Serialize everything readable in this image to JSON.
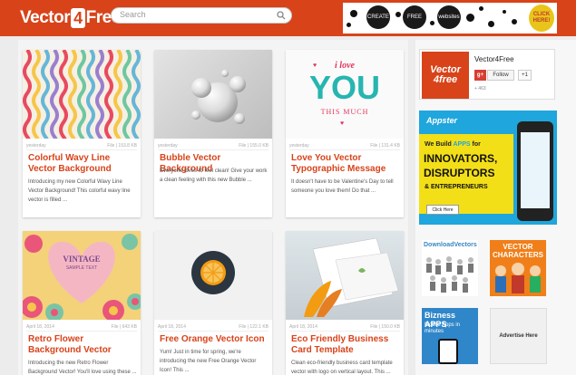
{
  "header": {
    "logo_text_pre": "Vector",
    "logo_text_num": "4",
    "logo_text_post": "Free",
    "search_placeholder": "Search",
    "top_ad": {
      "bubbles": [
        "CREATE",
        "FREE",
        "websites"
      ],
      "click_here": "CLICK HERE!"
    }
  },
  "posts": [
    {
      "title": "Colorful Wavy Line Vector Background",
      "desc": "Introducing my new Colorful Wavy Line Vector Background! This colorful wavy line vector is filled ...",
      "date": "yesterday",
      "size": "File | 153.8 KB"
    },
    {
      "title": "Bubble Vector Background",
      "desc": "Everyone loves to feel clean! Give your work a clean feeling with this new Bubble ...",
      "date": "yesterday",
      "size": "File | 155.0 KB"
    },
    {
      "title": "Love You Vector Typographic Message",
      "desc": "It doesn't have to be Valentine's Day to tell someone you love them! Do that ...",
      "date": "yesterday",
      "size": "File | 131.4 KB",
      "art": {
        "line1": "i love",
        "line2": "YOU",
        "line3": "THIS MUCH"
      }
    },
    {
      "title": "Retro Flower Background Vector",
      "desc": "Introducing the new Retro Flower Background Vector! You'll love using these ...",
      "date": "April 18, 2014",
      "size": "File | 643 KB",
      "art": {
        "line1": "VINTAGE",
        "line2": "SAMPLE TEXT"
      }
    },
    {
      "title": "Free Orange Vector Icon",
      "desc": "Yum! Just in time for spring, we're introducing the new Free Orange Vector Icon! This ...",
      "date": "April 18, 2014",
      "size": "File | 122.1 KB"
    },
    {
      "title": "Eco Friendly Business Card Template",
      "desc": "Clean eco-friendly business card template vector with logo on vertical layout. This ...",
      "date": "April 18, 2014",
      "size": "File | 150.0 KB"
    }
  ],
  "sidebar": {
    "gplus": {
      "logo": "Vector 4free",
      "name": "Vector4Free",
      "gplus_label": "g+",
      "follow": "Follow",
      "plus_one": "+1",
      "count": "+ 463"
    },
    "appster": {
      "brand": "Appster",
      "line1_pre": "We Build ",
      "line1_em": "APPS",
      "line1_post": " for",
      "big1": "INNOVATORS,",
      "big2": "DISRUPTORS",
      "line3": "& ENTREPRENEURS",
      "button": "Click Here"
    },
    "ads": {
      "download_vectors": "DownloadVectors",
      "vector_characters": "VECTOR CHARACTERS",
      "bizness_apps": "Bizness APPS",
      "bizness_sub": "Mobile Apps in minutes",
      "advertise": "Advertise Here"
    }
  },
  "colors": {
    "brand": "#d8431a",
    "link": "#d8431a",
    "appster_blue": "#1fa6dc",
    "appster_yellow": "#f3df17"
  }
}
